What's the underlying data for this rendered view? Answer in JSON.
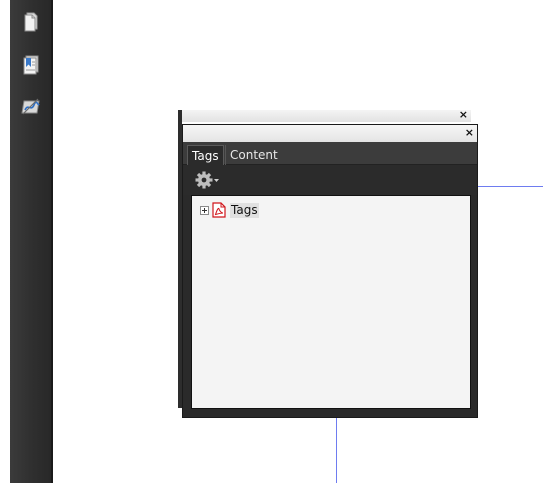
{
  "panel": {
    "tabs": [
      {
        "label": "Tags",
        "active": true
      },
      {
        "label": "Content",
        "active": false
      }
    ],
    "close_glyph": "×",
    "toolbar": {
      "options_icon": "gear-dropdown-icon"
    },
    "tree": {
      "root": {
        "label": "Tags",
        "icon": "pdf-document-icon",
        "expander": "plus"
      }
    }
  },
  "nav_rail": {
    "items": [
      {
        "icon": "page-thumbnails-icon"
      },
      {
        "icon": "bookmarks-icon"
      },
      {
        "icon": "signatures-icon"
      }
    ]
  },
  "colors": {
    "rail": "#2f2f2f",
    "panel_dark": "#2a2a2a",
    "tree_bg": "#f4f4f4",
    "guide_line": "#6e7cf0",
    "pdf_red": "#d0151b"
  }
}
